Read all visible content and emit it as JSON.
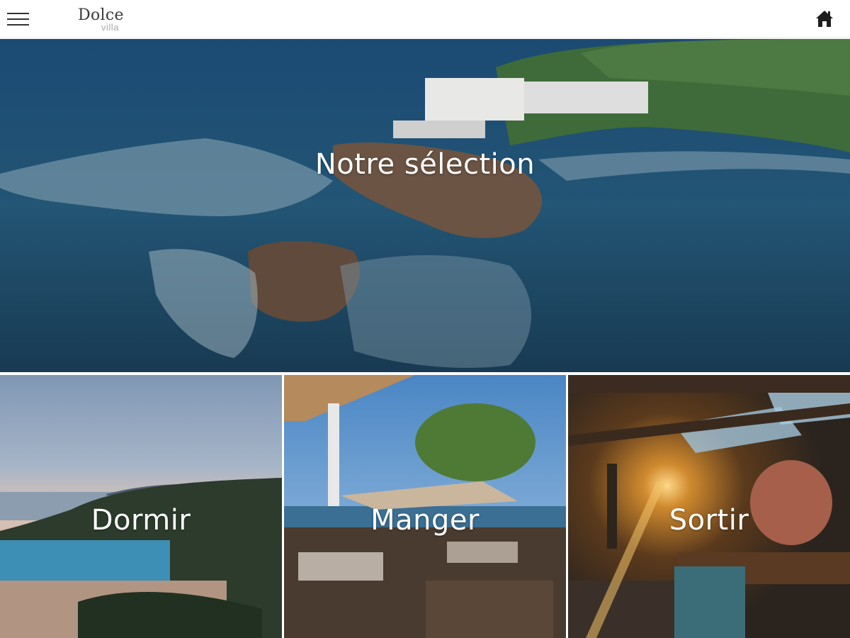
{
  "header": {
    "menu_icon": "hamburger-menu-icon",
    "logo": {
      "main": "Dolce",
      "sub": "villa"
    },
    "home_icon": "home-icon"
  },
  "hero": {
    "label": "Notre sélection"
  },
  "tiles": [
    {
      "label": "Dormir"
    },
    {
      "label": "Manger"
    },
    {
      "label": "Sortir"
    }
  ],
  "colors": {
    "header_bg": "#ffffff",
    "label_text": "#ffffff",
    "icon": "#222222",
    "divider": "#ffffff"
  }
}
